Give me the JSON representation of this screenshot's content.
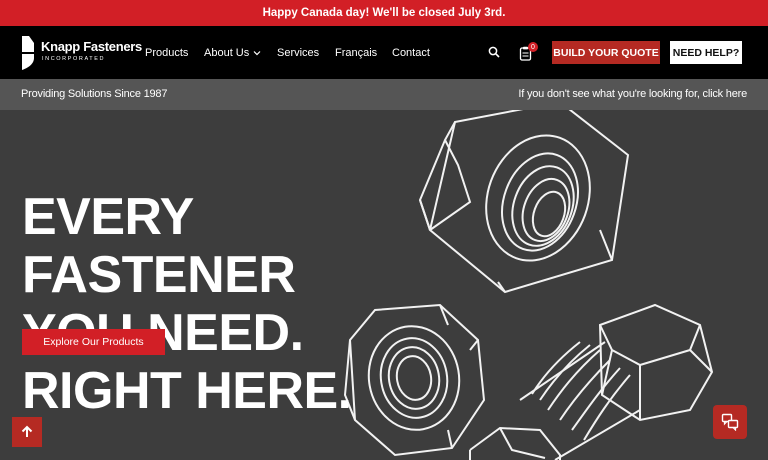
{
  "announcement": "Happy Canada day! We'll be closed July 3rd.",
  "brand": {
    "name": "Knapp Fasteners",
    "sub": "INCORPORATED"
  },
  "nav": {
    "items": [
      "Products",
      "About Us",
      "Services",
      "Français",
      "Contact"
    ],
    "cart_count": "0",
    "quote_label": "BUILD YOUR QUOTE",
    "help_label": "NEED HELP?"
  },
  "subbar": {
    "left": "Providing Solutions Since 1987",
    "right": "If you don't see what you're looking for, click here"
  },
  "hero": {
    "headline": [
      "EVERY",
      "FASTENER",
      "YOU NEED.",
      "RIGHT HERE."
    ],
    "cta": "Explore Our Products"
  },
  "icons": [
    "search-icon",
    "cart-icon",
    "chevron-down-icon",
    "arrow-up-icon",
    "chat-icon"
  ],
  "colors": {
    "accent": "#d21f26",
    "button": "#b52a23",
    "nav_bg": "#000000",
    "hero_bg": "#3d3d3d",
    "subbar_bg": "#555555"
  }
}
